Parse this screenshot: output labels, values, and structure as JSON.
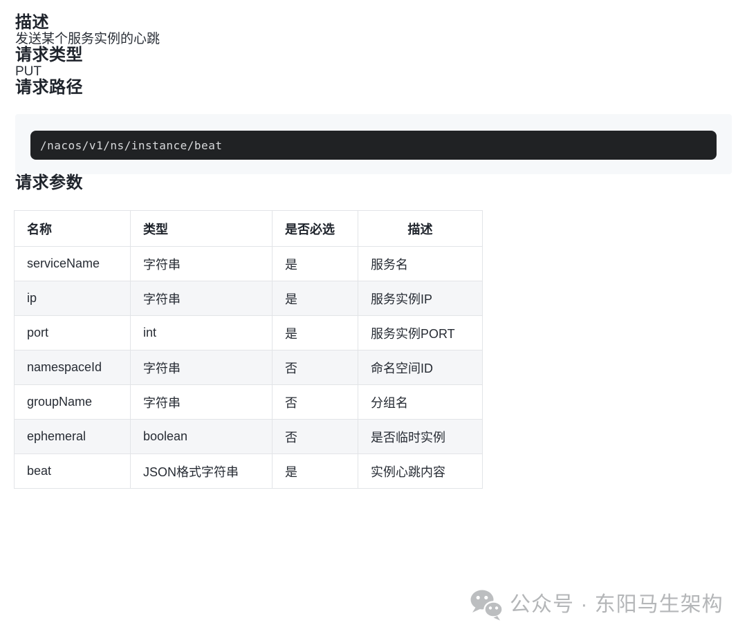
{
  "description": {
    "heading": "描述",
    "body": "发送某个服务实例的心跳"
  },
  "request_type": {
    "heading": "请求类型",
    "value": "PUT"
  },
  "request_path": {
    "heading": "请求路径",
    "code": "/nacos/v1/ns/instance/beat"
  },
  "request_params": {
    "heading": "请求参数",
    "table": {
      "headers": [
        "名称",
        "类型",
        "是否必选",
        "描述"
      ],
      "rows": [
        [
          "serviceName",
          "字符串",
          "是",
          "服务名"
        ],
        [
          "ip",
          "字符串",
          "是",
          "服务实例IP"
        ],
        [
          "port",
          "int",
          "是",
          "服务实例PORT"
        ],
        [
          "namespaceId",
          "字符串",
          "否",
          "命名空间ID"
        ],
        [
          "groupName",
          "字符串",
          "否",
          "分组名"
        ],
        [
          "ephemeral",
          "boolean",
          "否",
          "是否临时实例"
        ],
        [
          "beat",
          "JSON格式字符串",
          "是",
          "实例心跳内容"
        ]
      ]
    }
  },
  "watermark": {
    "icon": "wechat-icon",
    "text": "公众号 · 东阳马生架构"
  },
  "colors": {
    "code_panel_bg": "#f6f8fa",
    "code_box_bg": "#202224",
    "code_text": "#d8dadc",
    "table_border": "#e2e4e7",
    "row_stripe": "#f5f6f8",
    "heading_text": "#1e232b",
    "watermark_gray": "#b4b6b8"
  }
}
